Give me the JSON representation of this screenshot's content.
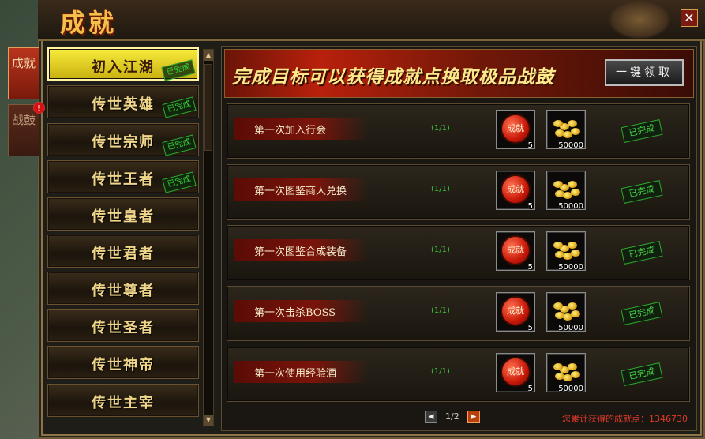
{
  "window": {
    "title": "成就",
    "close_label": "✕"
  },
  "side_tabs": [
    {
      "label": "成就",
      "active": true
    },
    {
      "label": "战鼓",
      "active": false,
      "alert": "!"
    }
  ],
  "list": {
    "items": [
      {
        "label": "初入江湖",
        "done": "已完成",
        "active": true
      },
      {
        "label": "传世英雄",
        "done": "已完成"
      },
      {
        "label": "传世宗师",
        "done": "已完成"
      },
      {
        "label": "传世王者",
        "done": "已完成"
      },
      {
        "label": "传世皇者",
        "done": ""
      },
      {
        "label": "传世君者",
        "done": ""
      },
      {
        "label": "传世尊者",
        "done": ""
      },
      {
        "label": "传世圣者",
        "done": ""
      },
      {
        "label": "传世神帝",
        "done": ""
      },
      {
        "label": "传世主宰",
        "done": ""
      }
    ],
    "scroll_up": "▲",
    "scroll_down": "▼"
  },
  "banner": {
    "text": "完成目标可以获得成就点换取极品战鼓",
    "claim_all_label": "一键领取"
  },
  "rows": [
    {
      "name": "第一次加入行会",
      "progress": "(1/1)",
      "reward_a_label": "成就",
      "reward_a_count": "5",
      "reward_b_count": "50000",
      "status": "已完成"
    },
    {
      "name": "第一次图鉴商人兑换",
      "progress": "(1/1)",
      "reward_a_label": "成就",
      "reward_a_count": "5",
      "reward_b_count": "50000",
      "status": "已完成"
    },
    {
      "name": "第一次图鉴合成装备",
      "progress": "(1/1)",
      "reward_a_label": "成就",
      "reward_a_count": "5",
      "reward_b_count": "50000",
      "status": "已完成"
    },
    {
      "name": "第一次击杀BOSS",
      "progress": "(1/1)",
      "reward_a_label": "成就",
      "reward_a_count": "5",
      "reward_b_count": "50000",
      "status": "已完成"
    },
    {
      "name": "第一次使用经验酒",
      "progress": "(1/1)",
      "reward_a_label": "成就",
      "reward_a_count": "5",
      "reward_b_count": "50000",
      "status": "已完成"
    }
  ],
  "pager": {
    "prev": "◀",
    "next": "▶",
    "label": "1/2"
  },
  "footer": {
    "points_text": "您累计获得的成就点：1346730"
  },
  "colors": {
    "gold": "#f4c04a",
    "done_green": "#3ad03a",
    "accent_red": "#b8200c"
  }
}
